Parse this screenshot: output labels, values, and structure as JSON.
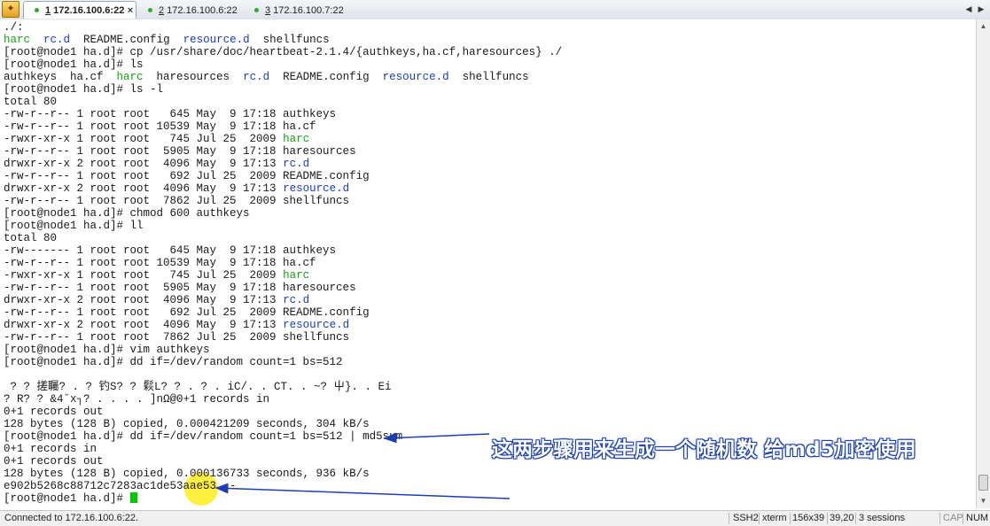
{
  "app": {
    "icon": "session-manager-icon",
    "tabs": [
      {
        "num": "1",
        "label": " 172.16.100.6:22",
        "active": true
      },
      {
        "num": "2",
        "label": " 172.16.100.6:22",
        "active": false
      },
      {
        "num": "3",
        "label": " 172.16.100.7:22",
        "active": false
      }
    ],
    "close_glyph": "×"
  },
  "terminal": {
    "lines": [
      [
        {
          "t": "./:"
        }
      ],
      [
        {
          "t": "harc",
          "c": "green"
        },
        {
          "t": "  "
        },
        {
          "t": "rc.d",
          "c": "blue"
        },
        {
          "t": "  README.config  "
        },
        {
          "t": "resource.d",
          "c": "blue"
        },
        {
          "t": "  shellfuncs"
        }
      ],
      [
        {
          "t": "[root@node1 ha.d]# cp /usr/share/doc/heartbeat-2.1.4/{authkeys,ha.cf,haresources} ./"
        }
      ],
      [
        {
          "t": "[root@node1 ha.d]# ls"
        }
      ],
      [
        {
          "t": "authkeys  ha.cf  "
        },
        {
          "t": "harc",
          "c": "green"
        },
        {
          "t": "  haresources  "
        },
        {
          "t": "rc.d",
          "c": "blue"
        },
        {
          "t": "  README.config  "
        },
        {
          "t": "resource.d",
          "c": "blue"
        },
        {
          "t": "  shellfuncs"
        }
      ],
      [
        {
          "t": "[root@node1 ha.d]# ls -l"
        }
      ],
      [
        {
          "t": "total 80"
        }
      ],
      [
        {
          "t": "-rw-r--r-- 1 root root   645 May  9 17:18 authkeys"
        }
      ],
      [
        {
          "t": "-rw-r--r-- 1 root root 10539 May  9 17:18 ha.cf"
        }
      ],
      [
        {
          "t": "-rwxr-xr-x 1 root root   745 Jul 25  2009 "
        },
        {
          "t": "harc",
          "c": "green"
        }
      ],
      [
        {
          "t": "-rw-r--r-- 1 root root  5905 May  9 17:18 haresources"
        }
      ],
      [
        {
          "t": "drwxr-xr-x 2 root root  4096 May  9 17:13 "
        },
        {
          "t": "rc.d",
          "c": "blue"
        }
      ],
      [
        {
          "t": "-rw-r--r-- 1 root root   692 Jul 25  2009 README.config"
        }
      ],
      [
        {
          "t": "drwxr-xr-x 2 root root  4096 May  9 17:13 "
        },
        {
          "t": "resource.d",
          "c": "blue"
        }
      ],
      [
        {
          "t": "-rw-r--r-- 1 root root  7862 Jul 25  2009 shellfuncs"
        }
      ],
      [
        {
          "t": "[root@node1 ha.d]# chmod 600 authkeys"
        }
      ],
      [
        {
          "t": "[root@node1 ha.d]# ll"
        }
      ],
      [
        {
          "t": "total 80"
        }
      ],
      [
        {
          "t": "-rw------- 1 root root   645 May  9 17:18 authkeys"
        }
      ],
      [
        {
          "t": "-rw-r--r-- 1 root root 10539 May  9 17:18 ha.cf"
        }
      ],
      [
        {
          "t": "-rwxr-xr-x 1 root root   745 Jul 25  2009 "
        },
        {
          "t": "harc",
          "c": "green"
        }
      ],
      [
        {
          "t": "-rw-r--r-- 1 root root  5905 May  9 17:18 haresources"
        }
      ],
      [
        {
          "t": "drwxr-xr-x 2 root root  4096 May  9 17:13 "
        },
        {
          "t": "rc.d",
          "c": "blue"
        }
      ],
      [
        {
          "t": "-rw-r--r-- 1 root root   692 Jul 25  2009 README.config"
        }
      ],
      [
        {
          "t": "drwxr-xr-x 2 root root  4096 May  9 17:13 "
        },
        {
          "t": "resource.d",
          "c": "blue"
        }
      ],
      [
        {
          "t": "-rw-r--r-- 1 root root  7862 Jul 25  2009 shellfuncs"
        }
      ],
      [
        {
          "t": "[root@node1 ha.d]# vim authkeys"
        }
      ],
      [
        {
          "t": "[root@node1 ha.d]# dd if=/dev/random count=1 bs=512"
        }
      ],
      [
        {
          "t": ""
        }
      ],
      [
        {
          "t": " ? ? 搓矚? . ? 钓S? ? 鬏L? ? . ? . iC/. . CT. . ~? 屮}. . Ei"
        }
      ],
      [
        {
          "t": "? R? ? &4˘x┐? . . . . ]nΩ@0+1 records in"
        }
      ],
      [
        {
          "t": "0+1 records out"
        }
      ],
      [
        {
          "t": "128 bytes (128 B) copied, 0.000421209 seconds, 304 kB/s"
        }
      ],
      [
        {
          "t": "[root@node1 ha.d]# dd if=/dev/random count=1 bs=512 | md5sum"
        }
      ],
      [
        {
          "t": "0+1 records in"
        }
      ],
      [
        {
          "t": "0+1 records out"
        }
      ],
      [
        {
          "t": "128 bytes (128 B) copied, 0.000136733 seconds, 936 kB/s"
        }
      ],
      [
        {
          "t": "e902b5268c88712c7283ac1de53aae53  -"
        }
      ],
      [
        {
          "t": "[root@node1 ha.d]# "
        },
        {
          "cursor": true
        }
      ]
    ],
    "colors": {
      "green": "#16a016",
      "blue": "#1a3cc8",
      "cursor": "#00c800"
    },
    "annotation_text": "这两步骤用来生成一个随机数 给md5加密使用",
    "annotation_color": "#1b3fb0"
  },
  "statusbar": {
    "connection": "Connected to 172.16.100.6:22.",
    "protocol": "SSH2",
    "terminal_type": "xterm",
    "size": "156x39",
    "cursor_pos": "39,20",
    "sessions": "3 sessions",
    "caps": "CAP",
    "num": "NUM"
  }
}
